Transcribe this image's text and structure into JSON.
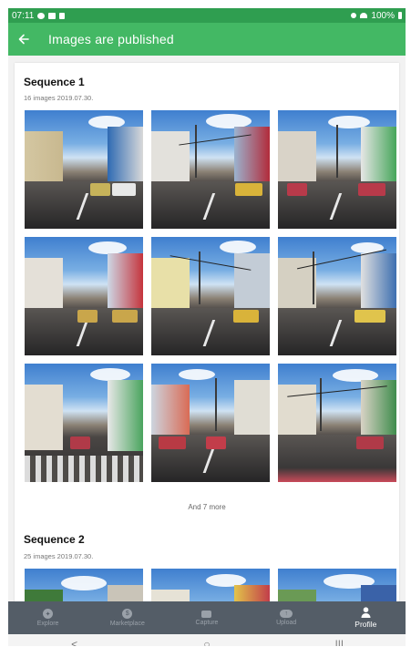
{
  "status_bar": {
    "time": "07:11",
    "battery": "100%"
  },
  "app_bar": {
    "title": "Images are published"
  },
  "sequences": [
    {
      "title": "Sequence 1",
      "meta": "16 images 2019.07.30.",
      "more": "And 7 more"
    },
    {
      "title": "Sequence 2",
      "meta": "25 images 2019.07.30."
    }
  ],
  "bottom_nav": {
    "items": [
      {
        "label": "Explore",
        "icon": "compass-icon"
      },
      {
        "label": "Marketplace",
        "icon": "dollar-icon"
      },
      {
        "label": "Capture",
        "icon": "video-camera-icon"
      },
      {
        "label": "Upload",
        "icon": "cloud-upload-icon"
      },
      {
        "label": "Profile",
        "icon": "person-icon",
        "active": true
      }
    ]
  },
  "system_nav": {
    "back": "<",
    "home": "○",
    "recents": "|||"
  },
  "colors": {
    "status_bar": "#2f9e50",
    "app_bar": "#43b864",
    "nav_bg": "#545d67",
    "nav_inactive": "#9aa1a9",
    "nav_active": "#ffffff"
  }
}
